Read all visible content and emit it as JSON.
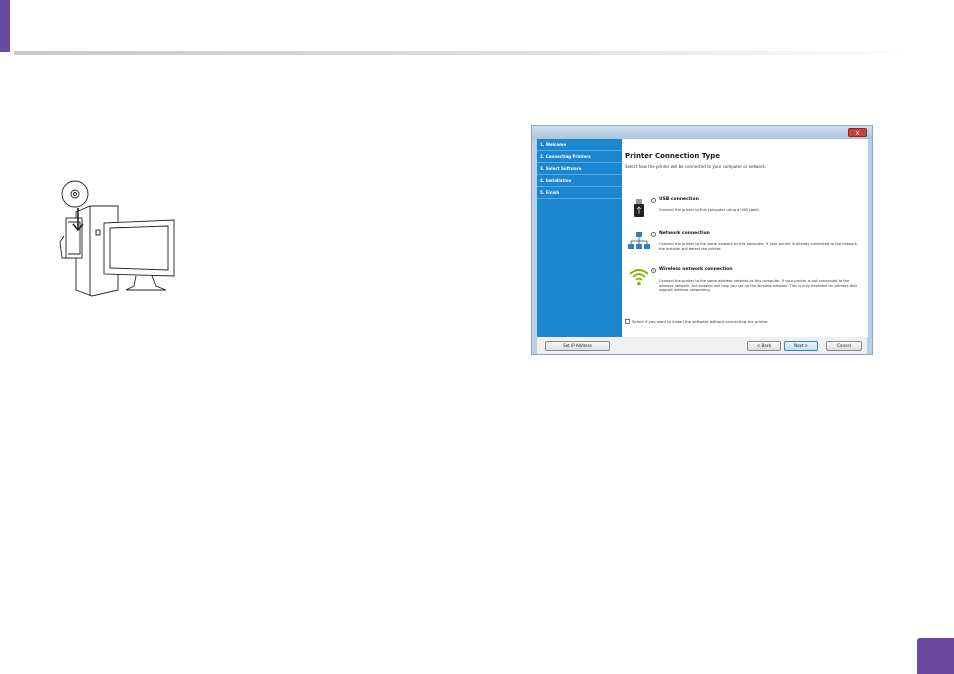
{
  "installer": {
    "close_label": "x",
    "steps": [
      "1. Welcome",
      "2. Connecting Printers",
      "3. Select Software",
      "4. Installation",
      "5. Finish"
    ],
    "title": "Printer Connection Type",
    "subtitle": "Select how the printer will be connected to your computer or network.",
    "options": [
      {
        "label": "USB connection",
        "description": "Connect the printer to this computer using a USB cable.",
        "icon": "usb-icon",
        "selected": false
      },
      {
        "label": "Network connection",
        "description": "Connect the printer to the same network as this computer. If your printer is already connected to the network, the installer will detect the printer.",
        "icon": "network-icon",
        "selected": false
      },
      {
        "label": "Wireless network connection",
        "description": "Connect the printer to the same wireless network as this computer. If your printer is not connected to the wireless network, the installer will help you set up the wireless network. This is only available for printers that support wireless networking.",
        "icon": "wifi-icon",
        "selected": true
      }
    ],
    "checkbox_label": "Select if you want to install the software without connecting the printer.",
    "buttons": {
      "set_ip": "Set IP Address",
      "back": "< Back",
      "next": "Next >",
      "cancel": "Cancel"
    }
  },
  "colors": {
    "accent": "#6a4a9f",
    "sidebar": "#1c86d1",
    "wifi": "#7ab800"
  }
}
